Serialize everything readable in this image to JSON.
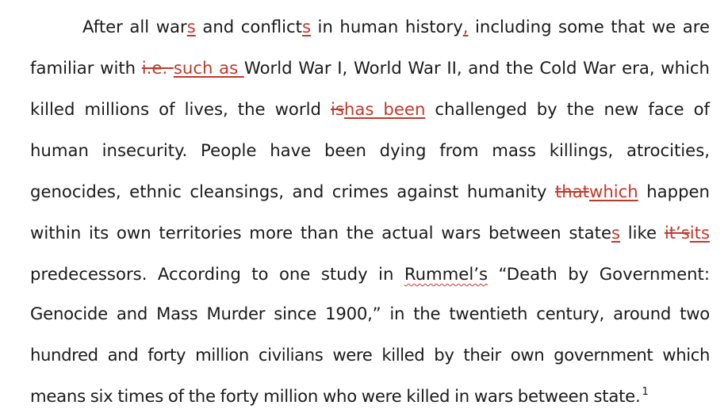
{
  "document": {
    "lines": [
      [
        {
          "t": "After all war"
        },
        {
          "t": "s",
          "type": "ins"
        },
        {
          "t": " and conflict"
        },
        {
          "t": "s",
          "type": "ins"
        },
        {
          "t": " in human history"
        },
        {
          "t": ",",
          "type": "ins"
        },
        {
          "t": " including some that we are"
        }
      ],
      [
        {
          "t": "familiar with "
        },
        {
          "t": "i.e. ",
          "type": "del"
        },
        {
          "t": "such as ",
          "type": "ins"
        },
        {
          "t": "World War I, World War II, and the Cold War era, which"
        }
      ],
      [
        {
          "t": "killed millions of lives, the world "
        },
        {
          "t": "is",
          "type": "del"
        },
        {
          "t": "has been",
          "type": "ins"
        },
        {
          "t": " challenged by the new face of"
        }
      ],
      [
        {
          "t": "human insecurity. People have been dying from mass killings, atrocities,"
        }
      ],
      [
        {
          "t": "genocides, ethnic cleansings, and crimes against humanity "
        },
        {
          "t": "that",
          "type": "del"
        },
        {
          "t": "which",
          "type": "ins"
        },
        {
          "t": " happen"
        }
      ],
      [
        {
          "t": "within its own territories more than the actual wars between state"
        },
        {
          "t": "s",
          "type": "ins"
        },
        {
          "t": " like "
        },
        {
          "t": "it’s",
          "type": "del"
        },
        {
          "t": "its",
          "type": "ins"
        }
      ],
      [
        {
          "t": "predecessors. According to one study in "
        },
        {
          "t": "Rummel’s",
          "type": "spell"
        },
        {
          "t": " “Death by Government:"
        }
      ],
      [
        {
          "t": "Genocide and Mass Murder since 1900,” in the twentieth century, around two"
        }
      ],
      [
        {
          "t": "hundred and forty million civilians were killed by their own government which"
        }
      ],
      [
        {
          "t": "means six times of the forty million who were killed in wars between state."
        },
        {
          "t": "1",
          "type": "sup"
        }
      ]
    ]
  }
}
